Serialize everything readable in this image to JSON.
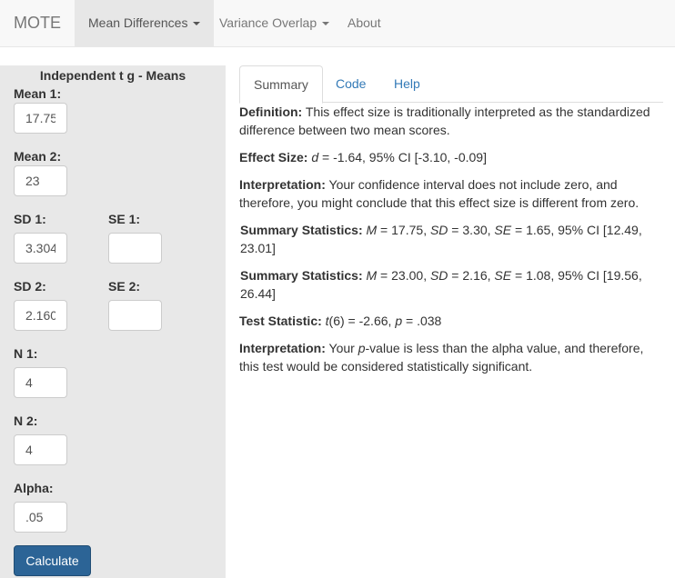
{
  "navbar": {
    "brand": "MOTE",
    "items": [
      {
        "label": "Mean Differences",
        "has_dropdown": true,
        "active": true
      },
      {
        "label": "Variance Overlap",
        "has_dropdown": true,
        "active": false
      },
      {
        "label": "About",
        "has_dropdown": false,
        "active": false
      }
    ]
  },
  "sidebar": {
    "title": "Independent t g - Means",
    "fields": {
      "mean1": {
        "label": "Mean 1:",
        "value": "17.75"
      },
      "mean2": {
        "label": "Mean 2:",
        "value": "23"
      },
      "sd1": {
        "label": "SD 1:",
        "value": "3.304"
      },
      "se1": {
        "label": "SE 1:",
        "value": ""
      },
      "sd2": {
        "label": "SD 2:",
        "value": "2.160"
      },
      "se2": {
        "label": "SE 2:",
        "value": ""
      },
      "n1": {
        "label": "N 1:",
        "value": "4"
      },
      "n2": {
        "label": "N 2:",
        "value": "4"
      },
      "alpha": {
        "label": "Alpha:",
        "value": ".05"
      }
    },
    "calculate_label": "Calculate"
  },
  "tabs": [
    {
      "label": "Summary",
      "active": true
    },
    {
      "label": "Code",
      "active": false
    },
    {
      "label": "Help",
      "active": false
    }
  ],
  "summary": {
    "definition": {
      "label": "Definition:",
      "text": " This effect size is traditionally interpreted as the standardized difference between two mean scores."
    },
    "effect_size": {
      "label": "Effect Size:",
      "sym": "d",
      "text": " = -1.64, 95% CI [-3.10, -0.09]"
    },
    "interpretation1": {
      "label": "Interpretation:",
      "text": " Your confidence interval does not include zero, and therefore, you might conclude that this effect size is different from zero."
    },
    "summary_stats_1": {
      "label": "Summary Statistics:",
      "M": "17.75",
      "SD": "3.30",
      "SE": "1.65",
      "CI": "95% CI [12.49, 23.01]"
    },
    "summary_stats_2": {
      "label": "Summary Statistics:",
      "M": "23.00",
      "SD": "2.16",
      "SE": "1.08",
      "CI": "95% CI [19.56, 26.44]"
    },
    "test_statistic": {
      "label": "Test Statistic:",
      "t_sym": "t",
      "df": "(6) = -2.66, ",
      "p_sym": "p",
      "p_text": " = .038"
    },
    "interpretation2": {
      "label": "Interpretation:",
      "pre": " Your ",
      "p_sym": "p",
      "text": "-value is less than the alpha value, and therefore, this test would be considered statistically significant."
    }
  },
  "symbols": {
    "M": "M",
    "SD": "SD",
    "SE": "SE",
    "eq": " = ",
    "comma": ", "
  }
}
